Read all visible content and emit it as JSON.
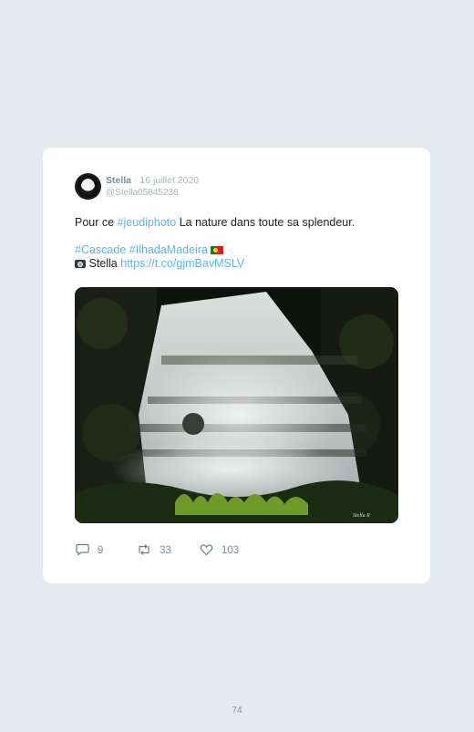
{
  "tweet": {
    "author_name": "Stella",
    "date": "· 16 juillet 2020",
    "handle": "@Stella05845236",
    "line1": {
      "prefix": "Pour ce ",
      "hashtag": "#jeudiphoto",
      "suffix": " La nature dans toute sa splendeur."
    },
    "hashtags": [
      "#Cascade",
      "#IlhadaMadeira"
    ],
    "credit_name": "Stella",
    "credit_link": "https://t.co/gjmBavMSLV",
    "image_alt": "Waterfall cascading over mossy rocks",
    "photo_signature": "Stella R",
    "stats": {
      "replies": "9",
      "retweets": "33",
      "likes": "103"
    }
  },
  "page_number": "74",
  "icons": {
    "reply": "speech-bubble-icon",
    "retweet": "retweet-arrows-icon",
    "like": "heart-icon",
    "flag": "portugal-flag-icon",
    "camera": "camera-icon"
  },
  "colors": {
    "background": "#e4ebee",
    "card": "#ffffff",
    "link": "#5bb6e6",
    "muted": "#a8b4ba"
  }
}
